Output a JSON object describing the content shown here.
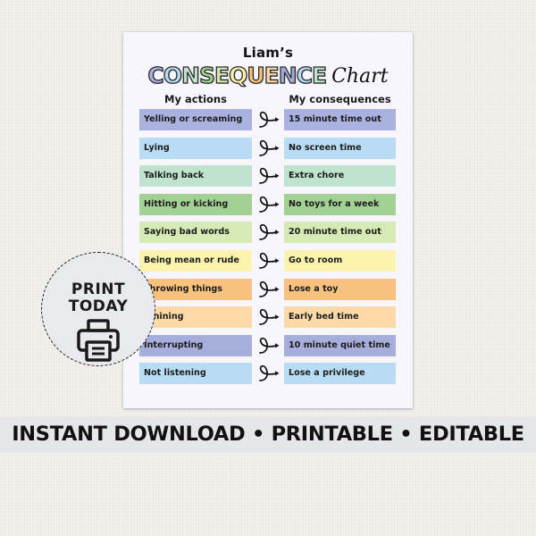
{
  "chart": {
    "owner_name": "Liam’s",
    "title_word": "CONSEQUENCE",
    "title_letter_colors": [
      "#a9b1e0",
      "#b5daf2",
      "#bfe3cf",
      "#9fcf8f",
      "#d4e9b0",
      "#fbf2a8",
      "#f9c07a",
      "#fdd9a6",
      "#a3acd9",
      "#b6daf5",
      "#bde5cf"
    ],
    "title_script": "Chart",
    "column_headers": {
      "actions": "My actions",
      "consequences": "My consequences"
    },
    "rows": [
      {
        "action": "Yelling or screaming",
        "consequence": "15 minute time out",
        "color": "#a9b1de"
      },
      {
        "action": "Lying",
        "consequence": "No screen time",
        "color": "#b7dcf4"
      },
      {
        "action": "Talking back",
        "consequence": "Extra chore",
        "color": "#c0e3d0"
      },
      {
        "action": "Hitting or kicking",
        "consequence": "No toys for a week",
        "color": "#a2d194"
      },
      {
        "action": "Saying bad words",
        "consequence": "20 minute time out",
        "color": "#d5eab4"
      },
      {
        "action": "Being mean or rude",
        "consequence": "Go to room",
        "color": "#faf3ad"
      },
      {
        "action": "Throwing things",
        "consequence": "Lose a toy",
        "color": "#f8c27e"
      },
      {
        "action": "Whining",
        "consequence": "Early bed time",
        "color": "#fdd9a8"
      },
      {
        "action": "Interrupting",
        "consequence": "10 minute quiet time",
        "color": "#a6aedb"
      },
      {
        "action": "Not listening",
        "consequence": "Lose a privilege",
        "color": "#b7dcf4"
      }
    ]
  },
  "badge": {
    "line1": "PRINT",
    "line2": "TODAY",
    "icon": "printer-icon"
  },
  "banner": {
    "text": "INSTANT DOWNLOAD • PRINTABLE • EDITABLE"
  }
}
